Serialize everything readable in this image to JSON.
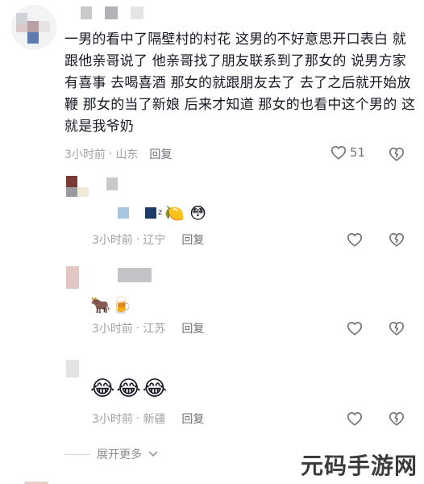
{
  "main_comment": {
    "text": "一男的看中了隔壁村的村花 这男的不好意思开口表白 就跟他亲哥说了 他亲哥找了朋友联系到了那女的 说男方家有喜事 去喝喜酒 那女的就跟朋友去了 去了之后就开始放鞭 那女的当了新娘 后来才知道 那女的也看中这个男的 这就是我爷奶",
    "time": "3小时前",
    "separator": "·",
    "location": "山东",
    "reply_label": "回复",
    "like_count": "51",
    "like_icon": "heart-outline-icon",
    "dislike_icon": "broken-heart-icon"
  },
  "replies": [
    {
      "emojis": [
        "🍋",
        "😳"
      ],
      "time": "3小时前",
      "separator": "·",
      "location": "辽宁",
      "reply_label": "回复"
    },
    {
      "emojis": [
        "🐂",
        "🍺"
      ],
      "time": "3小时前",
      "separator": "·",
      "location": "江苏",
      "reply_label": "回复"
    },
    {
      "emojis": [
        "😂",
        "😂",
        "😂"
      ],
      "time": "3小时前",
      "separator": "·",
      "location": "新疆",
      "reply_label": "回复"
    }
  ],
  "expand": {
    "label": "展开更多",
    "icon": "chevron-down-icon"
  },
  "watermark": "元码手游网",
  "colors": {
    "text_primary": "#161823",
    "text_meta": "#a0a1a6",
    "reply_link": "#6f7077",
    "icon": "#6f7077"
  }
}
